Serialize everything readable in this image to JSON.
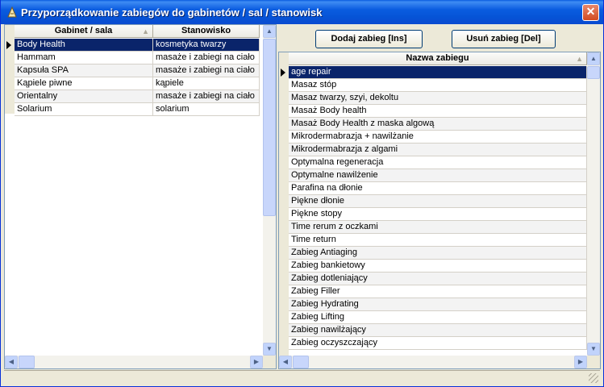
{
  "window": {
    "title": "Przyporządkowanie zabiegów do gabinetów / sal / stanowisk",
    "close_label": "✕"
  },
  "left_grid": {
    "columns": [
      "Gabinet / sala",
      "Stanowisko"
    ],
    "rows": [
      [
        "Body Health",
        "kosmetyka twarzy"
      ],
      [
        "Hammam",
        "masaże i zabiegi na ciało"
      ],
      [
        "Kapsuła SPA",
        "masaże i zabiegi na ciało"
      ],
      [
        "Kąpiele piwne",
        "kąpiele"
      ],
      [
        "Orientalny",
        "masaże i zabiegi na ciało"
      ],
      [
        "Solarium",
        "solarium"
      ]
    ]
  },
  "toolbar": {
    "add_label": "Dodaj zabieg [Ins]",
    "remove_label": "Usuń zabieg [Del]"
  },
  "right_grid": {
    "columns": [
      "Nazwa zabiegu"
    ],
    "rows": [
      "age repair",
      "Masaz stóp",
      "Masaz twarzy, szyi, dekoltu",
      "Masaż Body health",
      "Masaż Body Health z maska algową",
      "Mikrodermabrazja + nawilżanie",
      "Mikrodermabrazja z algami",
      "Optymalna regeneracja",
      "Optymalne nawilżenie",
      "Parafina na dłonie",
      "Piękne dłonie",
      "Piękne stopy",
      "Time rerum z oczkami",
      "Time return",
      "Zabieg Antiaging",
      "Zabieg bankietowy",
      "Zabieg dotleniający",
      "Zabieg Filler",
      "Zabieg Hydrating",
      "Zabieg Lifting",
      "Zabieg nawilżający",
      "Zabieg oczyszczający"
    ]
  }
}
